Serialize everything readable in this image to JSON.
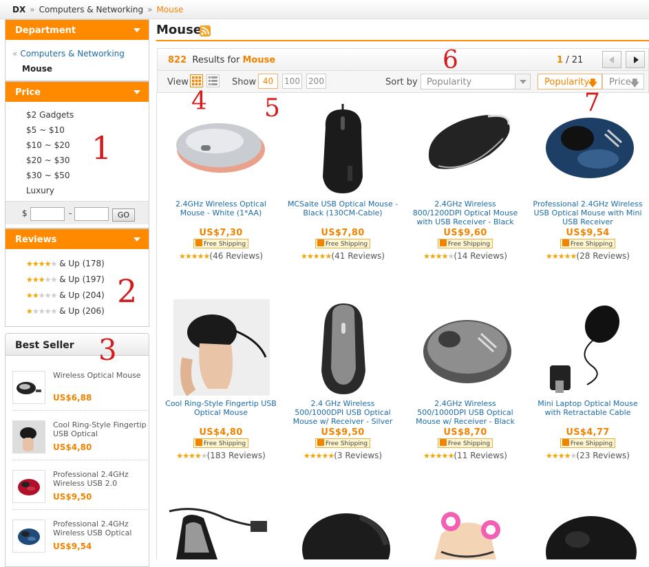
{
  "breadcrumb": {
    "root": "DX",
    "sep": "»",
    "category": "Computers & Networking",
    "current": "Mouse"
  },
  "sidebar": {
    "department": {
      "heading": "Department",
      "parent_marker": "«",
      "parent": "Computers & Networking",
      "current": "Mouse"
    },
    "price": {
      "heading": "Price",
      "ranges": [
        "$2 Gadgets",
        "$5 ~ $10",
        "$10 ~ $20",
        "$20 ~ $30",
        "$30 ~ $50",
        "Luxury"
      ],
      "currency": "$",
      "dash": "-",
      "go_label": "GO"
    },
    "reviews": {
      "heading": "Reviews",
      "items": [
        {
          "stars": 4,
          "label": "& Up (178)"
        },
        {
          "stars": 3,
          "label": "& Up (197)"
        },
        {
          "stars": 2,
          "label": "& Up (204)"
        },
        {
          "stars": 1,
          "label": "& Up (206)"
        }
      ]
    },
    "best_seller": {
      "heading": "Best Seller",
      "items": [
        {
          "name": "Wireless Optical Mouse",
          "price": "US$6,88"
        },
        {
          "name": "Cool Ring-Style Fingertip USB Optical",
          "price": "US$4,80"
        },
        {
          "name": "Professional 2.4GHz Wireless USB 2.0",
          "price": "US$9,50"
        },
        {
          "name": "Professional 2.4GHz Wireless USB Optical",
          "price": "US$9,54"
        }
      ]
    }
  },
  "main": {
    "title": "Mouse",
    "results": {
      "count": "822",
      "text": "Results for",
      "query": "Mouse"
    },
    "pager": {
      "current": "1",
      "total": "/ 21"
    },
    "view_label": "View",
    "show_label": "Show",
    "show_options": [
      "40",
      "100",
      "200"
    ],
    "sort_label": "Sort by",
    "sort_select": "Popularity",
    "sort_buttons": [
      {
        "label": "Popularity",
        "arrow": "🡇"
      },
      {
        "label": "Price",
        "arrow": "🡇"
      }
    ]
  },
  "products": [
    {
      "name": "2.4GHz Wireless Optical Mouse - White (1*AA)",
      "price": "US$7,30",
      "shipping": "Free Shipping",
      "stars": 5,
      "reviews": "(46 Reviews)"
    },
    {
      "name": "MCSaite USB Optical Mouse - Black (130CM-Cable)",
      "price": "US$7,80",
      "shipping": "Free Shipping",
      "stars": 5,
      "reviews": "(41 Reviews)"
    },
    {
      "name": "2.4GHz Wireless 800/1200DPI Optical Mouse with USB Receiver - Black",
      "price": "US$9,60",
      "shipping": "Free Shipping",
      "stars": 4,
      "reviews": "(14 Reviews)"
    },
    {
      "name": "Professional 2.4GHz Wireless USB Optical Mouse with Mini USB Receiver",
      "price": "US$9,54",
      "shipping": "Free Shipping",
      "stars": 5,
      "reviews": "(28 Reviews)"
    },
    {
      "name": "Cool Ring-Style Fingertip USB Optical Mouse",
      "price": "US$4,80",
      "shipping": "Free Shipping",
      "stars": 4,
      "reviews": "(183 Reviews)"
    },
    {
      "name": "2.4 GHz Wireless 500/1000DPI USB Optical Mouse w/ Receiver - Silver",
      "price": "US$9,50",
      "shipping": "Free Shipping",
      "stars": 5,
      "reviews": "(3 Reviews)"
    },
    {
      "name": "2.4GHz Wireless 500/1000DPI USB Optical Mouse w/ Receiver - Black",
      "price": "US$8,70",
      "shipping": "Free Shipping",
      "stars": 5,
      "reviews": "(11 Reviews)"
    },
    {
      "name": "Mini Laptop Optical Mouse with Retractable Cable",
      "price": "US$4,77",
      "shipping": "Free Shipping",
      "stars": 4,
      "reviews": "(23 Reviews)"
    }
  ],
  "annotations": [
    "1",
    "2",
    "3",
    "4",
    "5",
    "6",
    "7"
  ],
  "colors": {
    "accent": "#ff8a00",
    "price": "#f08300",
    "link": "#1a6ba8",
    "annotation": "#d41c1c"
  }
}
